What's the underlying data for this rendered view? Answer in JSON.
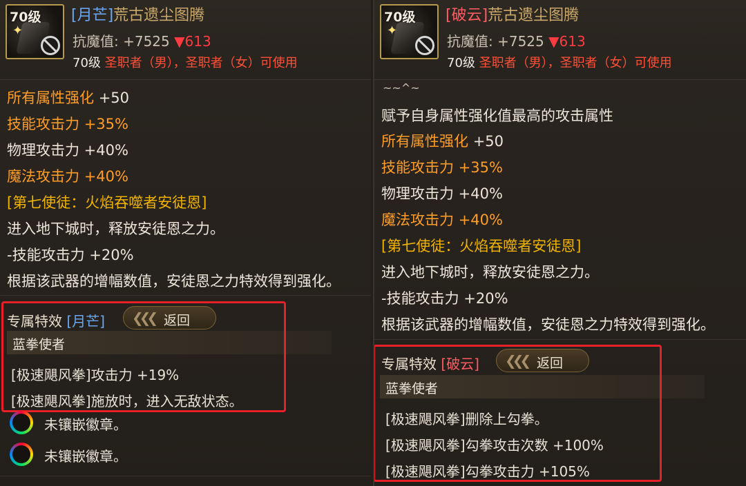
{
  "left": {
    "level_badge": "70级",
    "name_tag": "[月芒]",
    "name": "荒古遗尘图腾",
    "resist_label": "抗魔值: +7525",
    "resist_delta": "▼613",
    "usable_level": "70级",
    "usable_classes": "圣职者（男），圣职者（女）可使用",
    "stats": [
      {
        "label": "所有属性强化",
        "value": "+50"
      },
      {
        "label": "技能攻击力",
        "value": "+35%"
      },
      {
        "text": "物理攻击力 +40%"
      },
      {
        "label": "魔法攻击力",
        "value": "+40%"
      },
      {
        "text": "[第七使徒：火焰吞噬者安徒恩]"
      },
      {
        "text": "进入地下城时，释放安徒恩之力。"
      },
      {
        "text": "-技能攻击力 +20%"
      },
      {
        "text": "根据该武器的增幅数值，安徒恩之力特效得到强化。"
      }
    ],
    "exclusive_label": "专属特效",
    "exclusive_tag": "[月芒]",
    "back_label": "返回",
    "class_name": "蓝拳使者",
    "effects": [
      "[极速飓风拳]攻击力 +19%",
      "[极速飓风拳]施放时，进入无敌状态。"
    ],
    "sockets": [
      "未镶嵌徽章。",
      "未镶嵌徽章。"
    ]
  },
  "right": {
    "level_badge": "70级",
    "name_tag": "[破云]",
    "name": "荒古遗尘图腾",
    "resist_label": "抗魔值: +7525",
    "resist_delta": "▼613",
    "usable_level": "70级",
    "usable_classes": "圣职者（男），圣职者（女）可使用",
    "wave": "~~^~",
    "grant_text": "赋予自身属性强化值最高的攻击属性",
    "stats": [
      {
        "label": "所有属性强化",
        "value": "+50"
      },
      {
        "label": "技能攻击力",
        "value": "+35%"
      },
      {
        "text": "物理攻击力 +40%"
      },
      {
        "label": "魔法攻击力",
        "value": "+40%"
      },
      {
        "text": "[第七使徒：火焰吞噬者安徒恩]"
      },
      {
        "text": "进入地下城时，释放安徒恩之力。"
      },
      {
        "text": "-技能攻击力 +20%"
      },
      {
        "text": "根据该武器的增幅数值，安徒恩之力特效得到强化。"
      }
    ],
    "exclusive_label": "专属特效",
    "exclusive_tag": "[破云]",
    "back_label": "返回",
    "class_name": "蓝拳使者",
    "effects": [
      "[极速飓风拳]删除上勾拳。",
      "[极速飓风拳]勾拳攻击次数 +100%",
      "[极速飓风拳]勾拳攻击力 +105%"
    ]
  },
  "colors": {
    "orange": "#ff9d26",
    "gold": "#f0b400",
    "blue_tag": "#6aa7f0",
    "red_tag": "#ff5b63",
    "highlight_box": "#e8202a"
  }
}
